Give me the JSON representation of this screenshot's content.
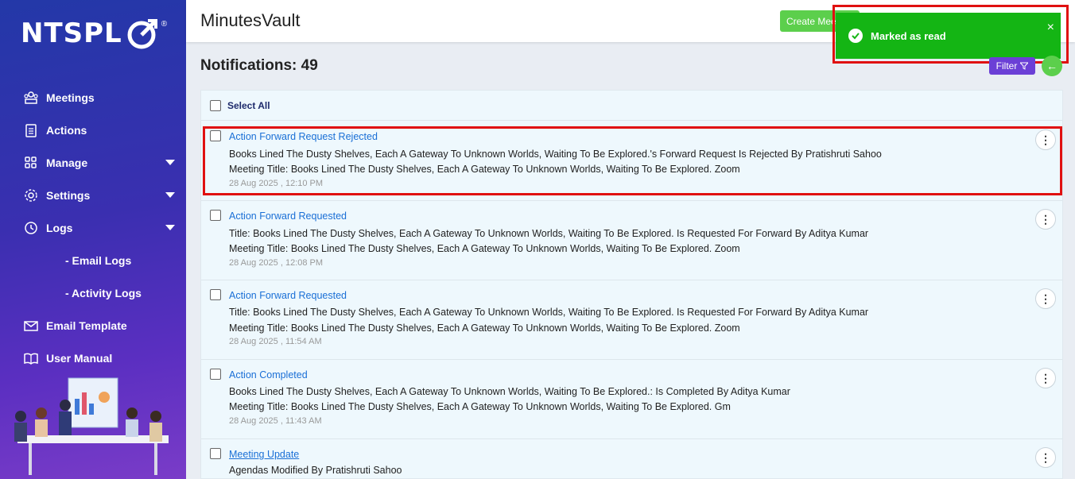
{
  "brand": {
    "logo_text": "NTSPL",
    "reg_mark": "®"
  },
  "sidebar": {
    "items": [
      {
        "label": "Meetings",
        "icon": "meetings-icon"
      },
      {
        "label": "Actions",
        "icon": "clipboard-icon"
      },
      {
        "label": "Manage",
        "icon": "grid-icon",
        "caret": true
      },
      {
        "label": "Settings",
        "icon": "gear-icon",
        "caret": true
      },
      {
        "label": "Logs",
        "icon": "history-icon",
        "caret": true
      },
      {
        "label": "- Email Logs",
        "sub": true
      },
      {
        "label": "- Activity Logs",
        "sub": true
      },
      {
        "label": "Email Template",
        "icon": "envelope-icon"
      },
      {
        "label": "User Manual",
        "icon": "book-icon"
      }
    ]
  },
  "header": {
    "title": "MinutesVault",
    "create_label": "Create Meeting"
  },
  "toast": {
    "message": "Marked as read",
    "close": "×",
    "color": "#14b514"
  },
  "page": {
    "title_prefix": "Notifications: ",
    "count": "49",
    "filter_label": "Filter",
    "back": "←"
  },
  "list": {
    "select_all": "Select All",
    "items": [
      {
        "title": "Action Forward Request Rejected",
        "line1": "Books Lined The Dusty Shelves, Each A Gateway To Unknown Worlds, Waiting To Be Explored.'s Forward Request Is Rejected By Pratishruti Sahoo",
        "line2": "Meeting Title: Books Lined The Dusty Shelves, Each A Gateway To Unknown Worlds, Waiting To Be Explored. Zoom",
        "date": "28 Aug 2025 , 12:10 PM"
      },
      {
        "title": "Action Forward Requested",
        "line1": "Title: Books Lined The Dusty Shelves, Each A Gateway To Unknown Worlds, Waiting To Be Explored. Is Requested For Forward By Aditya Kumar",
        "line2": "Meeting Title: Books Lined The Dusty Shelves, Each A Gateway To Unknown Worlds, Waiting To Be Explored. Zoom",
        "date": "28 Aug 2025 , 12:08 PM"
      },
      {
        "title": "Action Forward Requested",
        "line1": "Title: Books Lined The Dusty Shelves, Each A Gateway To Unknown Worlds, Waiting To Be Explored. Is Requested For Forward By Aditya Kumar",
        "line2": "Meeting Title: Books Lined The Dusty Shelves, Each A Gateway To Unknown Worlds, Waiting To Be Explored. Zoom",
        "date": "28 Aug 2025 , 11:54 AM"
      },
      {
        "title": "Action Completed",
        "line1": "Books Lined The Dusty Shelves, Each A Gateway To Unknown Worlds, Waiting To Be Explored.: Is Completed By Aditya Kumar",
        "line2": "Meeting Title: Books Lined The Dusty Shelves, Each A Gateway To Unknown Worlds, Waiting To Be Explored. Gm",
        "date": "28 Aug 2025 , 11:43 AM"
      },
      {
        "title": "Meeting Update",
        "line1": "Agendas Modified By Pratishruti Sahoo",
        "line2": "",
        "date": ""
      }
    ]
  }
}
